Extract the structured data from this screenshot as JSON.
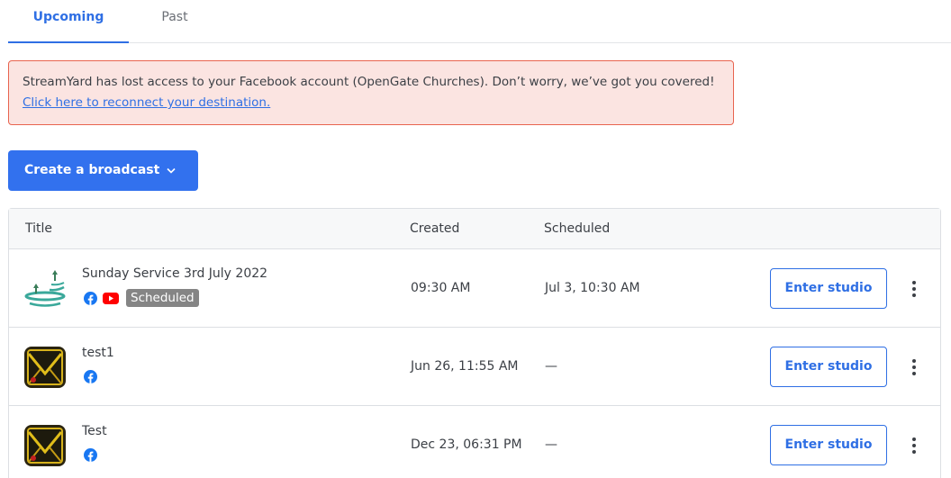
{
  "tabs": [
    {
      "label": "Upcoming",
      "active": true
    },
    {
      "label": "Past",
      "active": false
    }
  ],
  "alert": {
    "text": "StreamYard has lost access to your Facebook account (OpenGate Churches). Don’t worry, we’ve got you covered! ",
    "link_text": "Click here to reconnect your destination."
  },
  "create_button": {
    "label": "Create a broadcast",
    "chevron": "⌄"
  },
  "table": {
    "headers": {
      "title": "Title",
      "created": "Created",
      "scheduled": "Scheduled"
    },
    "rows": [
      {
        "title": "Sunday Service 3rd July 2022",
        "destinations": [
          "facebook-icon",
          "youtube-icon"
        ],
        "status": "Scheduled",
        "created": "09:30 AM",
        "scheduled": "Jul 3, 10:30 AM",
        "action": "Enter studio",
        "thumb": "opengate-logo"
      },
      {
        "title": "test1",
        "destinations": [
          "facebook-icon"
        ],
        "status": "",
        "created": "Jun 26, 11:55 AM",
        "scheduled": "—",
        "action": "Enter studio",
        "thumb": "yellow-envelope-thumb"
      },
      {
        "title": "Test",
        "destinations": [
          "facebook-icon"
        ],
        "status": "",
        "created": "Dec 23, 06:31 PM",
        "scheduled": "—",
        "action": "Enter studio",
        "thumb": "yellow-envelope-thumb"
      }
    ]
  },
  "colors": {
    "accent": "#3271ee",
    "alert_bg": "#fbe4e1",
    "alert_border": "#e8644f",
    "badge": "#858585",
    "facebook": "#1877f2",
    "youtube": "#ff0000"
  }
}
